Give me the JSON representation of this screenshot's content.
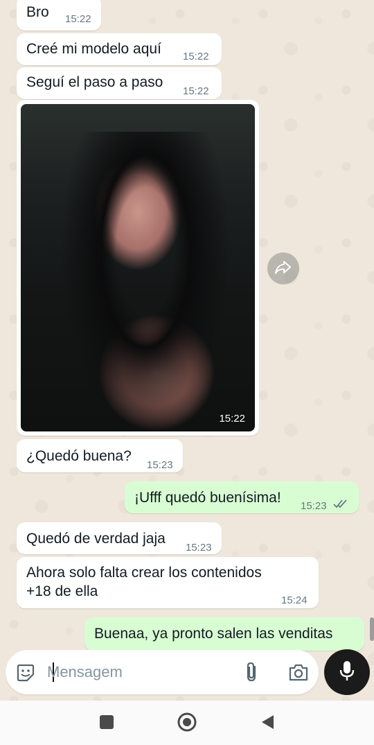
{
  "messages": [
    {
      "text": "Bro",
      "time": "15:22"
    },
    {
      "text": "Creé mi modelo aquí",
      "time": "15:22"
    },
    {
      "text": "Seguí el paso a paso",
      "time": "15:22"
    },
    {
      "image_time": "15:22"
    },
    {
      "text": "¿Quedó buena?",
      "time": "15:23"
    },
    {
      "text": "¡Ufff quedó buenísima!",
      "time": "15:23"
    },
    {
      "text": "Quedó de verdad jaja",
      "time": "15:23"
    },
    {
      "text_line1": "Ahora solo falta crear los contenidos",
      "text_line2": "+18 de ella",
      "time": "15:24"
    },
    {
      "text": "Buenaa, ya pronto salen las venditas"
    }
  ],
  "composer": {
    "placeholder": "Mensagem"
  },
  "icons": {
    "emoji": "sticker-icon",
    "attach": "paperclip-icon",
    "camera": "camera-icon",
    "mic": "microphone-icon",
    "forward": "forward-icon",
    "nav_recents": "square-icon",
    "nav_home": "circle-icon",
    "nav_back": "triangle-back-icon"
  },
  "colors": {
    "incoming": "#ffffff",
    "outgoing": "#d9fdd3",
    "background": "#efe7dc",
    "read_ticks": "#53bdeb"
  }
}
